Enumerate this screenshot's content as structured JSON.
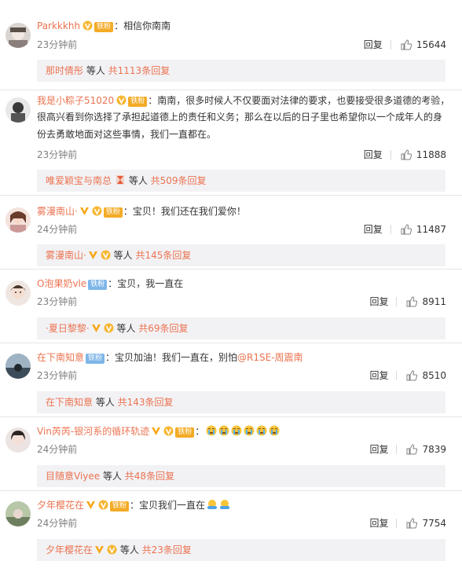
{
  "comments": [
    {
      "username": "Parkkkhh",
      "fan_badge": "铁粉",
      "text": "：相信你南南",
      "time": "23分钟前",
      "reply_label": "回复",
      "likes": "15644",
      "sub_user": "那时倩彤",
      "sub_mid": " 等人 ",
      "sub_total": "共1113条回复"
    },
    {
      "username": "我是小粽子51020",
      "fan_badge": "铁粉",
      "text_line1": "：南南，很多时候人不仅要面对法律的要求，也要接受很多道德的考验，",
      "text_line2": "很高兴看到你选择了承担起道德上的责任和义务；那么在以后的日子里也希望你以一个成年人的身",
      "text_line3": "份去勇敢地面对这些事情，我们一直都在。",
      "time": "23分钟前",
      "reply_label": "回复",
      "likes": "11888",
      "sub_user": "唯爱颖宝与南总",
      "sub_mid": " 等人 ",
      "sub_total": "共509条回复"
    },
    {
      "username": "雾漫南山·",
      "fan_badge": "铁粉",
      "text": "：宝贝！我们还在我们爱你！",
      "time": "24分钟前",
      "reply_label": "回复",
      "likes": "11487",
      "sub_user": "雾漫南山·",
      "sub_mid": " 等人 ",
      "sub_total": "共145条回复"
    },
    {
      "username": "O泡果奶vle",
      "fan_badge": "铁粉",
      "text": "：宝贝，我一直在",
      "time": "23分钟前",
      "reply_label": "回复",
      "likes": "8911",
      "sub_user": "·夏日黎黎·",
      "sub_mid": " 等人 ",
      "sub_total": "共69条回复"
    },
    {
      "username": "在下南知意",
      "fan_badge": "铁粉",
      "text_pre": "：宝贝加油！我们一直在，别怕",
      "mention": "@R1SE-周震南",
      "time": "23分钟前",
      "reply_label": "回复",
      "likes": "8510",
      "sub_user": "在下南知意",
      "sub_mid": " 等人 ",
      "sub_total": "共143条回复"
    },
    {
      "username": "Vin芮芮-银河系的循环轨迹",
      "fan_badge": "铁粉",
      "text": "：",
      "time": "24分钟前",
      "reply_label": "回复",
      "likes": "7839",
      "sub_user": "目随意Viyee",
      "sub_mid": " 等人 ",
      "sub_total": "共48条回复"
    },
    {
      "username": "夕年樱花在",
      "fan_badge": "铁粉",
      "text": "：宝贝我们一直在",
      "time": "24分钟前",
      "reply_label": "回复",
      "likes": "7754",
      "sub_user": "夕年樱花在",
      "sub_mid": " 等人 ",
      "sub_total": "共23条回复"
    }
  ]
}
